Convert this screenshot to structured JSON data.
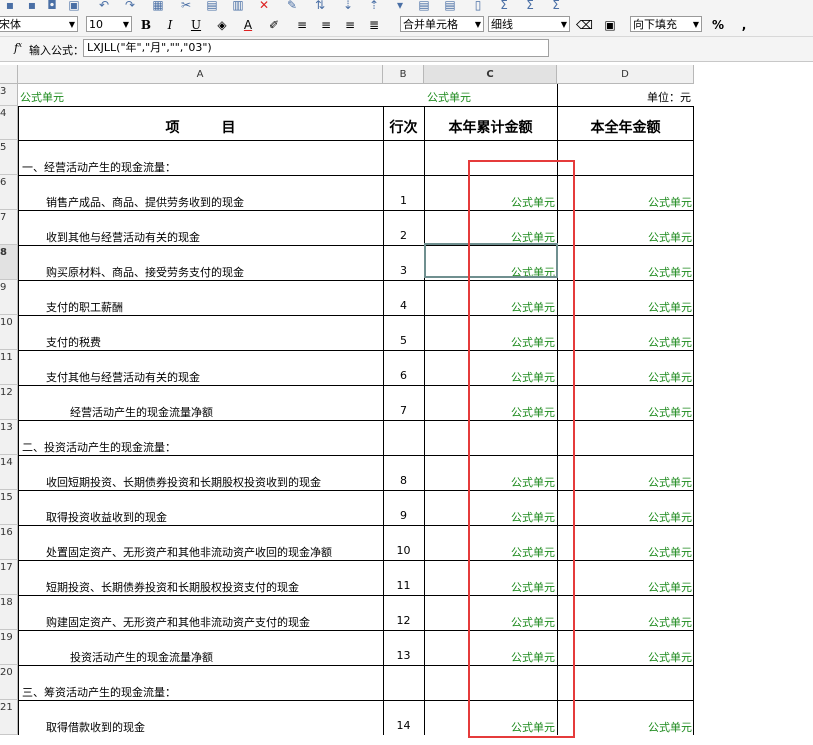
{
  "toolbar": {
    "font_name": "宋体",
    "font_size": "10",
    "bold": "B",
    "italic": "I",
    "underline": "U",
    "font_color": "A",
    "merge_cells": "合并单元格",
    "border_style": "细线",
    "fill_direction": "向下填充",
    "percent": "%",
    "comma": ","
  },
  "formula_bar": {
    "fx": "f",
    "label": "输入公式：",
    "value": "LXJLL(\"年\",\"月\",\"\",\"03\")"
  },
  "columns": [
    {
      "id": "A",
      "label": "A"
    },
    {
      "id": "B",
      "label": "B"
    },
    {
      "id": "C",
      "label": "C"
    },
    {
      "id": "D",
      "label": "D"
    }
  ],
  "header_row": {
    "a3": "公式单元",
    "c3": "公式单元",
    "d3": "单位：元",
    "item": "项　　　目",
    "line_no": "行次",
    "ytd": "本年累计金额",
    "full_year": "本全年金额"
  },
  "formula_cell_text": "公式单元",
  "rows": [
    {
      "row": "5",
      "label": "一、经营活动产生的现金流量：",
      "line": "",
      "section": true
    },
    {
      "row": "6",
      "label": "销售产成品、商品、提供劳务收到的现金",
      "line": "1"
    },
    {
      "row": "7",
      "label": "收到其他与经营活动有关的现金",
      "line": "2"
    },
    {
      "row": "8",
      "label": "购买原材料、商品、接受劳务支付的现金",
      "line": "3"
    },
    {
      "row": "9",
      "label": "支付的职工薪酬",
      "line": "4"
    },
    {
      "row": "10",
      "label": "支付的税费",
      "line": "5"
    },
    {
      "row": "11",
      "label": "支付其他与经营活动有关的现金",
      "line": "6"
    },
    {
      "row": "12",
      "label": "经营活动产生的现金流量净额",
      "line": "7",
      "subtotal": true
    },
    {
      "row": "13",
      "label": "二、投资活动产生的现金流量：",
      "line": "",
      "section": true
    },
    {
      "row": "14",
      "label": "收回短期投资、长期债券投资和长期股权投资收到的现金",
      "line": "8"
    },
    {
      "row": "15",
      "label": "取得投资收益收到的现金",
      "line": "9"
    },
    {
      "row": "16",
      "label": "处置固定资产、无形资产和其他非流动资产收回的现金净额",
      "line": "10"
    },
    {
      "row": "17",
      "label": "短期投资、长期债券投资和长期股权投资支付的现金",
      "line": "11"
    },
    {
      "row": "18",
      "label": "购建固定资产、无形资产和其他非流动资产支付的现金",
      "line": "12"
    },
    {
      "row": "19",
      "label": "投资活动产生的现金流量净额",
      "line": "13",
      "subtotal": true
    },
    {
      "row": "20",
      "label": "三、筹资活动产生的现金流量：",
      "line": "",
      "section": true
    },
    {
      "row": "21",
      "label": "取得借款收到的现金",
      "line": "14"
    }
  ]
}
